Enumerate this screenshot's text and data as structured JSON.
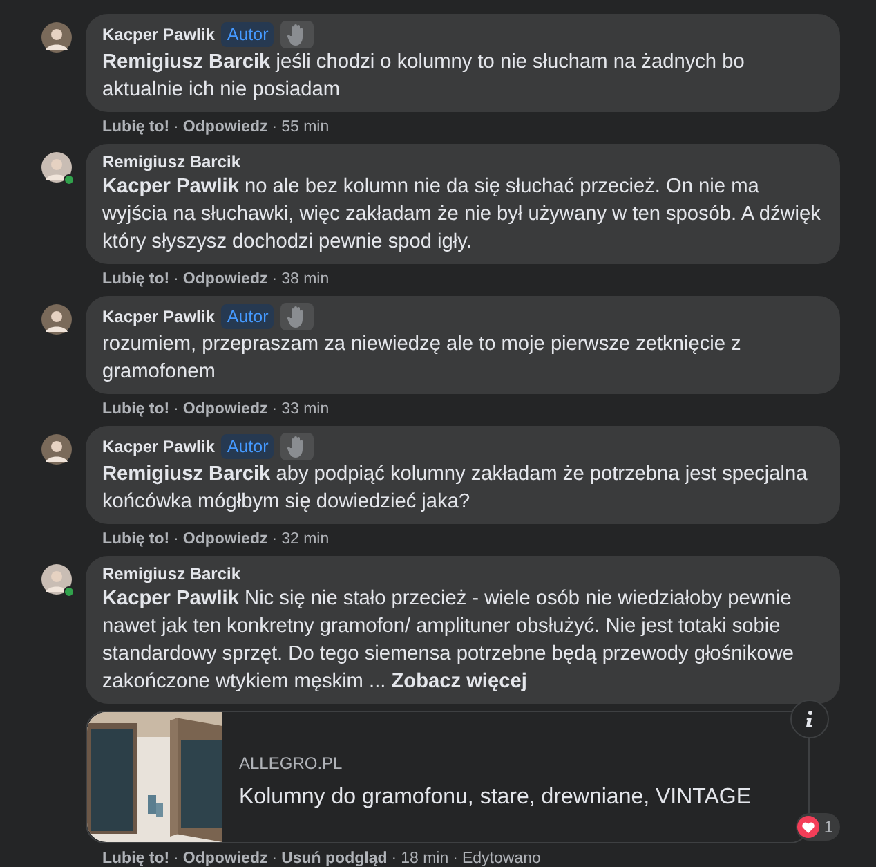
{
  "comments": [
    {
      "author": "Kacper Pawlik",
      "online": false,
      "badge": "Autor",
      "wave": true,
      "text": "**Remigiusz Barcik** jeśli chodzi o kolumny to nie słucham na żadnych bo aktualnie ich nie posiadam",
      "meta": [
        {
          "kind": "link",
          "text": "Lubię to!"
        },
        {
          "kind": "sep",
          "text": "·"
        },
        {
          "kind": "link",
          "text": "Odpowiedz"
        },
        {
          "kind": "sep",
          "text": "·"
        },
        {
          "kind": "time",
          "text": "55 min"
        }
      ]
    },
    {
      "author": "Remigiusz Barcik",
      "online": true,
      "text": "**Kacper Pawlik** no ale bez kolumn nie da się słuchać przecież. On nie ma wyjścia na słuchawki, więc zakładam że nie był używany w ten sposób. A dźwięk który słyszysz dochodzi pewnie spod igły.",
      "meta": [
        {
          "kind": "link",
          "text": "Lubię to!"
        },
        {
          "kind": "sep",
          "text": "·"
        },
        {
          "kind": "link",
          "text": "Odpowiedz"
        },
        {
          "kind": "sep",
          "text": "·"
        },
        {
          "kind": "time",
          "text": "38 min"
        }
      ]
    },
    {
      "author": "Kacper Pawlik",
      "online": false,
      "badge": "Autor",
      "wave": true,
      "text": "rozumiem, przepraszam za niewiedzę ale to moje pierwsze zetknięcie z gramofonem",
      "meta": [
        {
          "kind": "link",
          "text": "Lubię to!"
        },
        {
          "kind": "sep",
          "text": "·"
        },
        {
          "kind": "link",
          "text": "Odpowiedz"
        },
        {
          "kind": "sep",
          "text": "·"
        },
        {
          "kind": "time",
          "text": "33 min"
        }
      ]
    },
    {
      "author": "Kacper Pawlik",
      "online": false,
      "badge": "Autor",
      "wave": true,
      "text": "**Remigiusz Barcik** aby podpiąć kolumny zakładam że potrzebna jest specjalna końcówka mógłbym się dowiedzieć jaka?",
      "meta": [
        {
          "kind": "link",
          "text": "Lubię to!"
        },
        {
          "kind": "sep",
          "text": "·"
        },
        {
          "kind": "link",
          "text": "Odpowiedz"
        },
        {
          "kind": "sep",
          "text": "·"
        },
        {
          "kind": "time",
          "text": "32 min"
        }
      ]
    },
    {
      "author": "Remigiusz Barcik",
      "online": true,
      "text": "**Kacper Pawlik** Nic się nie stało przecież - wiele osób nie wiedziałoby pewnie nawet jak ten konkretny gramofon/ amplituner obsłużyć. Nie jest totaki sobie standardowy sprzęt. Do tego siemensa potrzebne będą przewody głośnikowe zakończone wtykiem męskim ...",
      "see_more": "Zobacz więcej",
      "link_preview": {
        "domain": "ALLEGRO.PL",
        "title": "Kolumny do gramofonu, stare, drewniane, VINTAGE"
      },
      "reactions": "1",
      "meta": [
        {
          "kind": "link",
          "text": "Lubię to!"
        },
        {
          "kind": "sep",
          "text": "·"
        },
        {
          "kind": "link",
          "text": "Odpowiedz"
        },
        {
          "kind": "sep",
          "text": "·"
        },
        {
          "kind": "link",
          "text": "Usuń podgląd"
        },
        {
          "kind": "sep",
          "text": "·"
        },
        {
          "kind": "time",
          "text": "18 min"
        },
        {
          "kind": "sep",
          "text": "·"
        },
        {
          "kind": "plain",
          "text": "Edytowano"
        }
      ]
    }
  ]
}
